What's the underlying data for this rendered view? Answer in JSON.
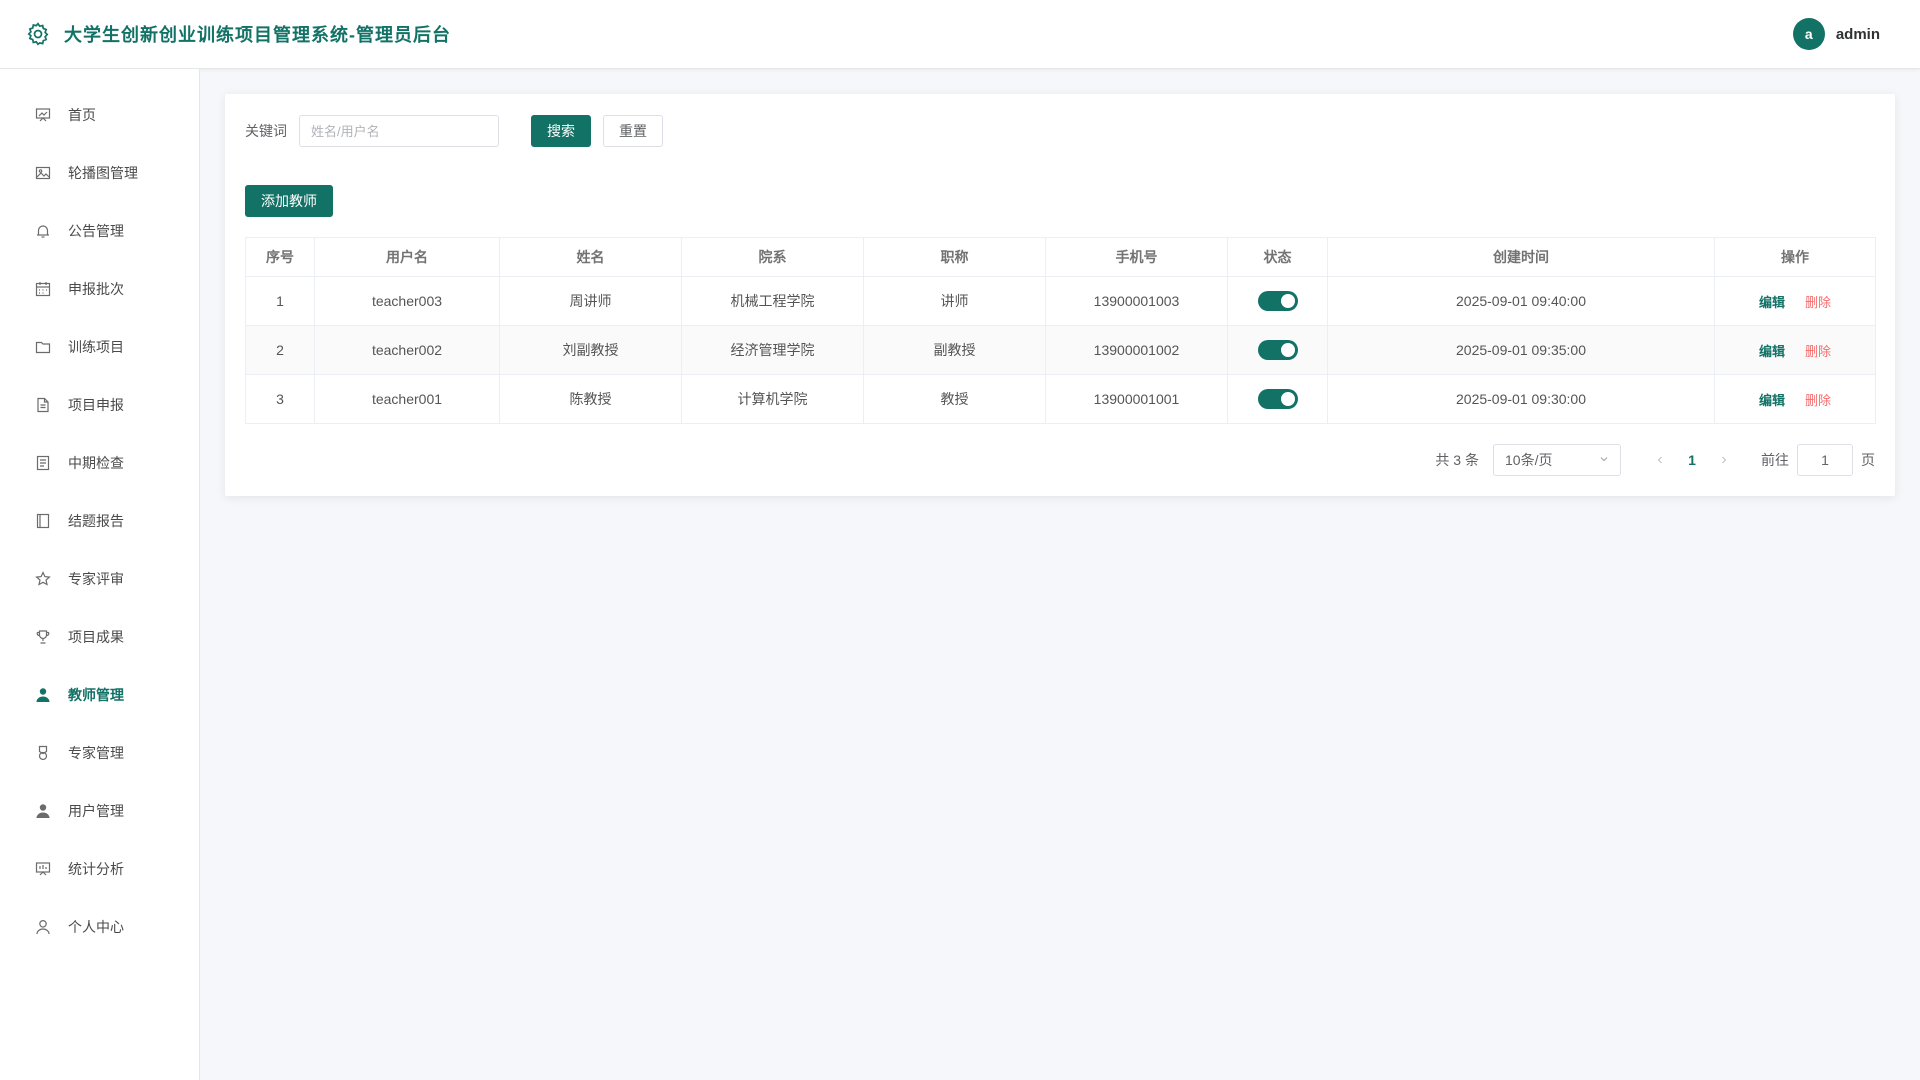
{
  "header": {
    "title": "大学生创新创业训练项目管理系统-管理员后台",
    "avatar_letter": "a",
    "username": "admin",
    "accent_color": "#137266"
  },
  "sidebar": {
    "items": [
      {
        "label": "首页",
        "icon": "chart-board-icon"
      },
      {
        "label": "轮播图管理",
        "icon": "picture-icon"
      },
      {
        "label": "公告管理",
        "icon": "bell-icon"
      },
      {
        "label": "申报批次",
        "icon": "calendar-icon"
      },
      {
        "label": "训练项目",
        "icon": "folder-icon"
      },
      {
        "label": "项目申报",
        "icon": "document-icon"
      },
      {
        "label": "中期检查",
        "icon": "tickets-icon"
      },
      {
        "label": "结题报告",
        "icon": "notebook-icon"
      },
      {
        "label": "专家评审",
        "icon": "star-icon"
      },
      {
        "label": "项目成果",
        "icon": "trophy-icon"
      },
      {
        "label": "教师管理",
        "icon": "user-filled-icon",
        "active": true
      },
      {
        "label": "专家管理",
        "icon": "medal-icon"
      },
      {
        "label": "用户管理",
        "icon": "user-filled-icon"
      },
      {
        "label": "统计分析",
        "icon": "data-board-icon"
      },
      {
        "label": "个人中心",
        "icon": "user-icon"
      }
    ]
  },
  "search": {
    "label": "关键词",
    "placeholder": "姓名/用户名",
    "value": "",
    "search_button": "搜索",
    "reset_button": "重置"
  },
  "add_button": "添加教师",
  "table": {
    "columns": [
      "序号",
      "用户名",
      "姓名",
      "院系",
      "职称",
      "手机号",
      "状态",
      "创建时间",
      "操作"
    ],
    "rows": [
      {
        "index": "1",
        "username": "teacher003",
        "name": "周讲师",
        "department": "机械工程学院",
        "title": "讲师",
        "phone": "13900001003",
        "enabled": true,
        "created": "2025-09-01 09:40:00"
      },
      {
        "index": "2",
        "username": "teacher002",
        "name": "刘副教授",
        "department": "经济管理学院",
        "title": "副教授",
        "phone": "13900001002",
        "enabled": true,
        "created": "2025-09-01 09:35:00"
      },
      {
        "index": "3",
        "username": "teacher001",
        "name": "陈教授",
        "department": "计算机学院",
        "title": "教授",
        "phone": "13900001001",
        "enabled": true,
        "created": "2025-09-01 09:30:00"
      }
    ],
    "edit_label": "编辑",
    "delete_label": "删除"
  },
  "pagination": {
    "total": "共 3 条",
    "page_size": "10条/页",
    "current_page": "1",
    "goto_label": "前往",
    "goto_value": "1",
    "goto_suffix": "页"
  }
}
